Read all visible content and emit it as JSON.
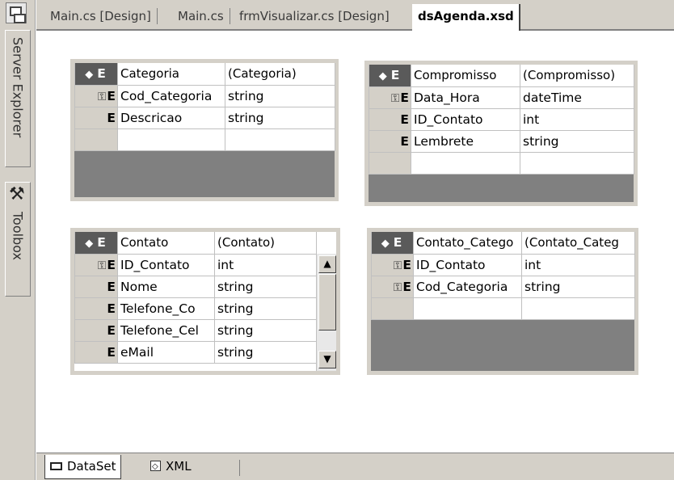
{
  "document_tabs": [
    {
      "label": "Main.cs [Design]"
    },
    {
      "label": "Main.cs"
    },
    {
      "label": "frmVisualizar.cs [Design]"
    },
    {
      "label": "dsAgenda.xsd",
      "active": true
    }
  ],
  "side_tabs": {
    "server_explorer": "Server Explorer",
    "toolbox": "Toolbox"
  },
  "element_marker": "E",
  "tables": {
    "categoria": {
      "name": "Categoria",
      "type": "(Categoria)",
      "rows": [
        {
          "key": true,
          "name": "Cod_Categoria",
          "type": "string"
        },
        {
          "key": false,
          "name": "Descricao",
          "type": "string"
        }
      ]
    },
    "compromisso": {
      "name": "Compromisso",
      "type": "(Compromisso)",
      "rows": [
        {
          "key": true,
          "name": "Data_Hora",
          "type": "dateTime"
        },
        {
          "key": false,
          "name": "ID_Contato",
          "type": "int"
        },
        {
          "key": false,
          "name": "Lembrete",
          "type": "string"
        }
      ]
    },
    "contato": {
      "name": "Contato",
      "type": "(Contato)",
      "rows": [
        {
          "key": true,
          "name": "ID_Contato",
          "type": "int"
        },
        {
          "key": false,
          "name": "Nome",
          "type": "string"
        },
        {
          "key": false,
          "name": "Telefone_Co",
          "type": "string"
        },
        {
          "key": false,
          "name": "Telefone_Cel",
          "type": "string"
        },
        {
          "key": false,
          "name": "eMail",
          "type": "string"
        }
      ]
    },
    "contato_categoria": {
      "name": "Contato_Catego",
      "type": "(Contato_Categ",
      "rows": [
        {
          "key": true,
          "name": "ID_Contato",
          "type": "int"
        },
        {
          "key": true,
          "name": "Cod_Categoria",
          "type": "string"
        }
      ]
    }
  },
  "bottom_tabs": [
    {
      "label": "DataSet",
      "active": true
    },
    {
      "label": "XML"
    }
  ]
}
